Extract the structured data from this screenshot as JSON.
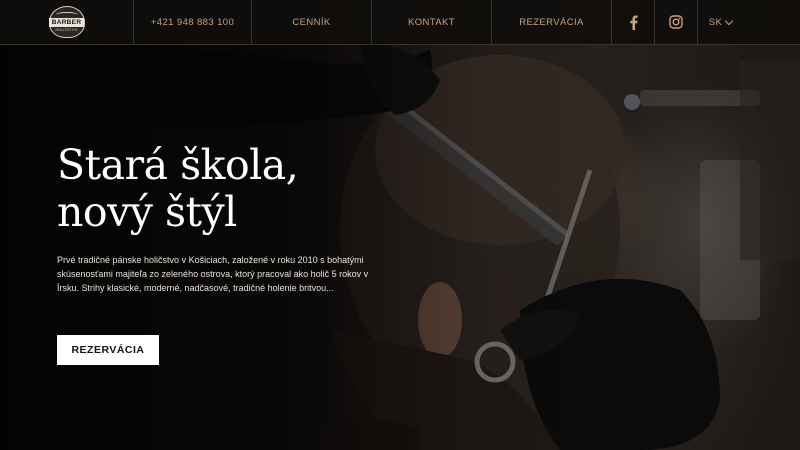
{
  "header": {
    "logo": {
      "text": "BARBER",
      "subtext": "HOLIČSTVO"
    },
    "phone": "+421 948 883 100",
    "nav": [
      {
        "label": "CENNÍK"
      },
      {
        "label": "KONTAKT"
      },
      {
        "label": "REZERVÁCIA"
      }
    ],
    "social": [
      {
        "icon": "facebook-icon"
      },
      {
        "icon": "instagram-icon"
      }
    ],
    "language": {
      "selected": "SK",
      "icon": "chevron-down-icon"
    }
  },
  "hero": {
    "title_line1": "Stará škola,",
    "title_line2": "nový štýl",
    "description": "Prvé tradičné pánske holičstvo v Košiciach, založené v roku 2010 s bohatými skúsenosťami majiteľa zo zeleného ostrova, ktorý pracoval ako holič 5 rokov v Írsku. Strihy klasické, moderné, nadčasové, tradičné holenie britvou...",
    "button_label": "REZERVÁCIA"
  },
  "colors": {
    "header_bg": "#100e0c",
    "accent_gold": "#c9a27a",
    "divider": "#3b342d",
    "button_bg": "#ffffff",
    "title_text": "#ffffff"
  }
}
